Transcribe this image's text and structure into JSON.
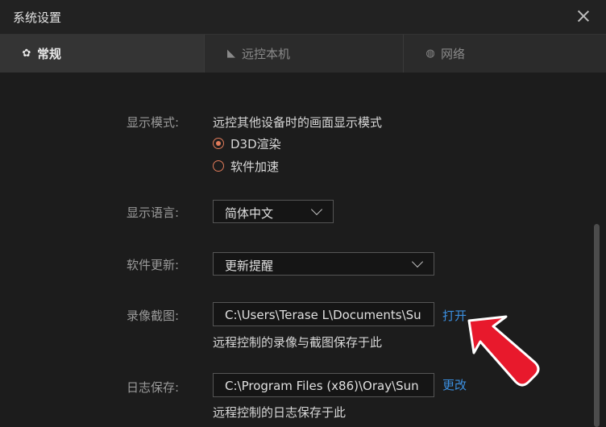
{
  "window": {
    "title": "系统设置"
  },
  "tabs": [
    {
      "label": "常规",
      "icon": "gear-icon"
    },
    {
      "label": "远控本机",
      "icon": "remote-icon"
    },
    {
      "label": "网络",
      "icon": "globe-icon"
    }
  ],
  "display_mode": {
    "label": "显示模式:",
    "description": "远控其他设备时的画面显示模式",
    "options": [
      {
        "label": "D3D渲染",
        "selected": true
      },
      {
        "label": "软件加速",
        "selected": false
      }
    ]
  },
  "display_language": {
    "label": "显示语言:",
    "value": "简体中文"
  },
  "software_update": {
    "label": "软件更新:",
    "value": "更新提醒"
  },
  "recording": {
    "label": "录像截图:",
    "path": "C:\\Users\\Terase L\\Documents\\Su",
    "action": "打开",
    "hint": "远程控制的录像与截图保存于此"
  },
  "log_save": {
    "label": "日志保存:",
    "path": "C:\\Program Files (x86)\\Oray\\Sun",
    "action": "更改",
    "hint": "远程控制的日志保存于此"
  },
  "colors": {
    "accent": "#e07b5a",
    "link": "#3b8fe0",
    "annotation_arrow": "#e8192c"
  }
}
